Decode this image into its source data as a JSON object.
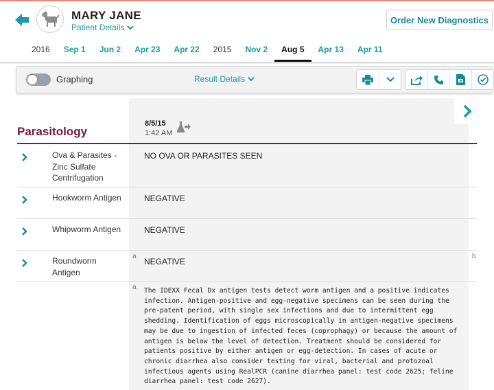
{
  "patient": {
    "name": "MARY JANE",
    "details_label": "Patient Details"
  },
  "header": {
    "order_button": "Order New Diagnostics"
  },
  "date_tabs": [
    {
      "label": "2016",
      "kind": "year"
    },
    {
      "label": "Sep 1",
      "kind": "date"
    },
    {
      "label": "Jun 2",
      "kind": "date"
    },
    {
      "label": "Apr 23",
      "kind": "date"
    },
    {
      "label": "Apr 22",
      "kind": "date"
    },
    {
      "label": "2015",
      "kind": "year"
    },
    {
      "label": "Nov 2",
      "kind": "date"
    },
    {
      "label": "Aug 5",
      "kind": "active"
    },
    {
      "label": "Apr 13",
      "kind": "date"
    },
    {
      "label": "Apr 11",
      "kind": "date"
    }
  ],
  "toolbar": {
    "graphing_label": "Graphing",
    "graphing_on": false,
    "result_details_label": "Result Details",
    "icons": [
      "print-icon",
      "chevron-down-icon",
      "share-icon",
      "phone-icon",
      "document-icon",
      "approve-icon"
    ]
  },
  "results": {
    "section_title": "Parasitology",
    "column_date": "8/5/15",
    "column_time": "1:42 AM",
    "rows": [
      {
        "name": "Ova & Parasites - Zinc Sulfate Centrifugation",
        "value": "NO OVA OR PARASITES SEEN",
        "mark": "",
        "right_mark": ""
      },
      {
        "name": "Hookworm Antigen",
        "value": "NEGATIVE",
        "mark": "",
        "right_mark": ""
      },
      {
        "name": "Whipworm Antigen",
        "value": "NEGATIVE",
        "mark": "",
        "right_mark": ""
      },
      {
        "name": "Roundworm Antigen",
        "value": "NEGATIVE",
        "mark": "a",
        "right_mark": "b"
      }
    ],
    "footnote": {
      "mark": "a",
      "text": "The IDEXX Fecal Dx antigen tests detect worm antigen and a positive indicates infection. Antigen-positive and egg-negative specimens can be seen during the pre-patent period, with single sex infections and due to intermittent egg shedding. Identification of eggs microscopically in antigen-negative specimens may be due to ingestion of infected feces (coprophagy) or because the amount of antigen is below the level of detection.  Treatment should be considered for patients positive by either antigen or egg-detection. In cases of acute or chronic diarrhea also consider testing for viral, bacterial and protozoal infectious agents using RealPCR (canine diarrhea panel: test code 2625; feline diarrhea panel: test code 2627)."
    }
  },
  "colors": {
    "accent": "#1a9aa8",
    "section": "#7a1a3a",
    "top_border": "#e48a78"
  }
}
